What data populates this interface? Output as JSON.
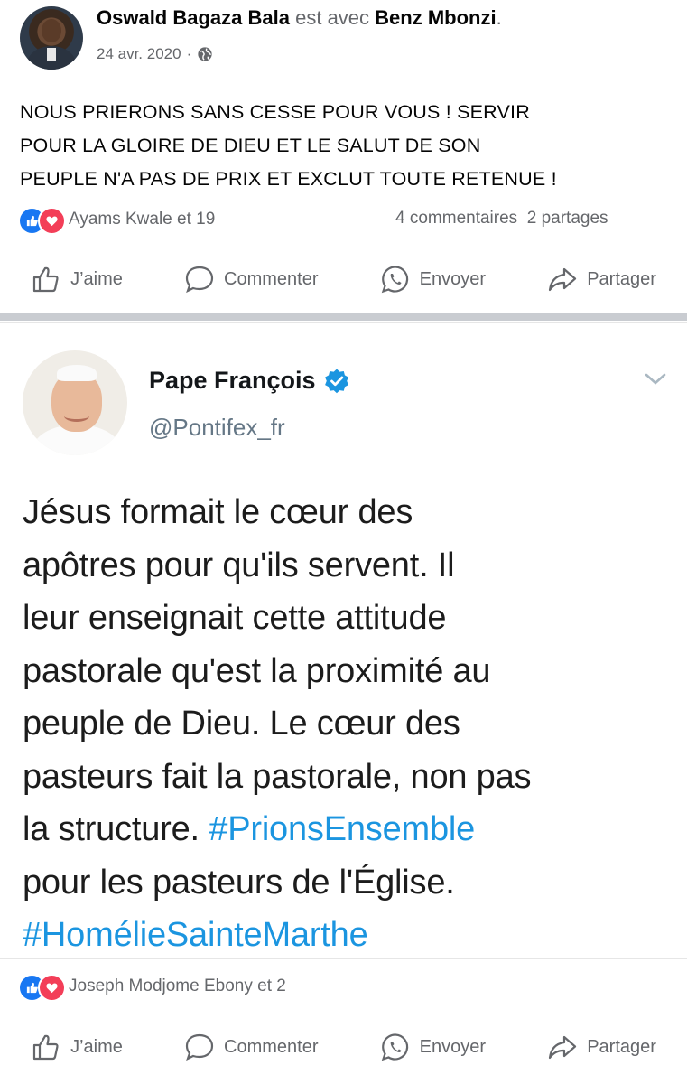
{
  "post": {
    "author": "Oswald Bagaza Bala",
    "with_text": "est avec",
    "tagged": "Benz Mbonzi",
    "period": ".",
    "date": "24 avr. 2020",
    "dot": "·",
    "privacy_icon": "globe-icon",
    "text_lines": [
      "NOUS PRIERONS SANS CESSE POUR VOUS ! SERVIR",
      "POUR LA GLOIRE DE DIEU ET LE SALUT DE SON",
      "PEUPLE N'A PAS DE PRIX ET EXCLUT TOUTE RETENUE !"
    ],
    "reactions_text": "Ayams Kwale et 19",
    "comments_count": "4 commentaires",
    "shares_count": "2 partages"
  },
  "actions": {
    "like": "J’aime",
    "comment": "Commenter",
    "send": "Envoyer",
    "share": "Partager"
  },
  "tweet": {
    "name": "Pape François",
    "handle": "@Pontifex_fr",
    "line1": "Jésus formait le cœur des",
    "line2": "apôtres pour qu'ils servent. Il",
    "line3": "leur enseignait cette attitude",
    "line4": "pastorale qu'est la proximité au",
    "line5": "peuple de Dieu. Le cœur des",
    "line6": "pasteurs fait la pastorale, non pas",
    "line7_a": "la structure. ",
    "line7_tag": "#PrionsEnsemble",
    "line8": "pour les pasteurs de l'Église.",
    "line9_tag": "#HomélieSainteMarthe"
  },
  "post2": {
    "reactions_text": "Joseph Modjome Ebony et 2"
  },
  "colors": {
    "facebook_blue": "#1877f2",
    "love_red": "#f33e58",
    "twitter_blue": "#1b95e0",
    "muted_grey": "#65676b",
    "divider": "#c9ccd1"
  }
}
